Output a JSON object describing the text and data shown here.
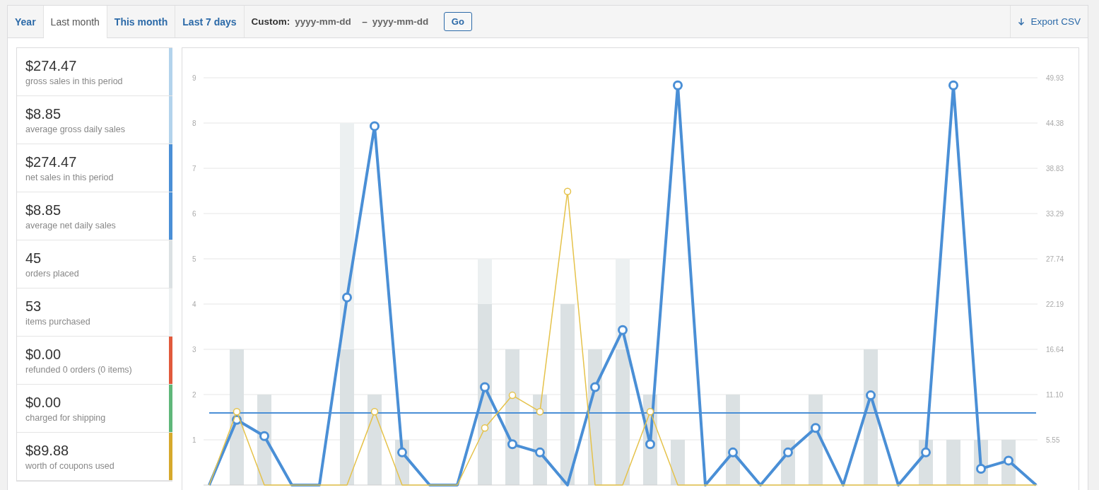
{
  "tabs": [
    {
      "label": "Year",
      "selected": false
    },
    {
      "label": "Last month",
      "selected": true
    },
    {
      "label": "This month",
      "selected": false
    },
    {
      "label": "Last 7 days",
      "selected": false
    }
  ],
  "custom_range": {
    "label": "Custom:",
    "start": {
      "placeholder": "yyyy-mm-dd"
    },
    "separator": "–",
    "end": {
      "placeholder": "yyyy-mm-dd"
    },
    "button": "Go"
  },
  "export": {
    "label": "Export CSV"
  },
  "legend": [
    {
      "value": "$274.47",
      "label": "gross sales in this period",
      "color": "#b3d3ec"
    },
    {
      "value": "$8.85",
      "label": "average gross daily sales",
      "color": "#b3d3ec"
    },
    {
      "value": "$274.47",
      "label": "net sales in this period",
      "color": "#4a8fd6"
    },
    {
      "value": "$8.85",
      "label": "average net daily sales",
      "color": "#4a8fd6"
    },
    {
      "value": "45",
      "label": "orders placed",
      "color": "#dbe1e3"
    },
    {
      "value": "53",
      "label": "items purchased",
      "color": "#ecf0f1"
    },
    {
      "value": "$0.00",
      "label": "refunded 0 orders (0 items)",
      "color": "#e15a3c"
    },
    {
      "value": "$0.00",
      "label": "charged for shipping",
      "color": "#5fb77a"
    },
    {
      "value": "$89.88",
      "label": "worth of coupons used",
      "color": "#d6a92c"
    }
  ],
  "bar_chart": {
    "chart_data": {
      "type": "bar",
      "ylim": [
        0,
        9
      ],
      "yticks": [
        1,
        2,
        3,
        4,
        5,
        6,
        7,
        8,
        9
      ],
      "grid": true,
      "stacked": true,
      "series": [
        {
          "color": "#dbe1e3",
          "values": [
            0,
            3,
            2,
            0,
            0,
            3,
            2,
            1,
            0,
            0,
            4,
            3,
            2,
            4,
            3,
            3,
            2,
            1,
            0,
            2,
            0,
            1,
            2,
            0,
            3,
            0,
            1,
            1,
            1,
            1,
            0
          ]
        },
        {
          "color": "#ecf0f1",
          "values": [
            0,
            0,
            0,
            0,
            0,
            5,
            0,
            0,
            0,
            0,
            1,
            0,
            0,
            0,
            0,
            2,
            0,
            0,
            0,
            0,
            0,
            0,
            0,
            0,
            0,
            0,
            0,
            0,
            0,
            0,
            0
          ]
        }
      ]
    }
  },
  "line_chart": {
    "chart_data": {
      "type": "line",
      "ylim": [
        0,
        49.93
      ],
      "yticks": [
        {
          "value": 5.55,
          "label": "5.55"
        },
        {
          "value": 11.1,
          "label": "11.10"
        },
        {
          "value": 16.64,
          "label": "16.64"
        },
        {
          "value": 22.19,
          "label": "22.19"
        },
        {
          "value": 27.74,
          "label": "27.74"
        },
        {
          "value": 33.29,
          "label": "33.29"
        },
        {
          "value": 38.83,
          "label": "38.83"
        },
        {
          "value": 44.38,
          "label": "44.38"
        },
        {
          "value": 49.93,
          "label": "49.93"
        }
      ],
      "ref_lines": [
        {
          "axis": "y",
          "value": 8.85,
          "color": "#4a8fd6"
        }
      ],
      "series": [
        {
          "color": "#4a8fd6",
          "values": [
            0,
            8,
            6,
            0,
            0,
            23,
            44,
            4,
            0,
            0,
            12,
            5,
            4,
            0,
            12,
            19,
            5,
            49,
            0,
            4,
            0,
            4,
            7,
            0,
            11,
            0,
            4,
            49,
            2,
            3,
            0
          ]
        },
        {
          "color": "#e5c24a",
          "values": [
            0,
            9,
            0,
            0,
            0,
            0,
            9,
            0,
            0,
            0,
            7,
            11,
            9,
            36,
            0,
            0,
            9,
            0,
            0,
            0,
            0,
            0,
            0,
            0,
            0,
            0,
            0,
            0,
            0,
            0,
            0
          ]
        }
      ]
    }
  }
}
